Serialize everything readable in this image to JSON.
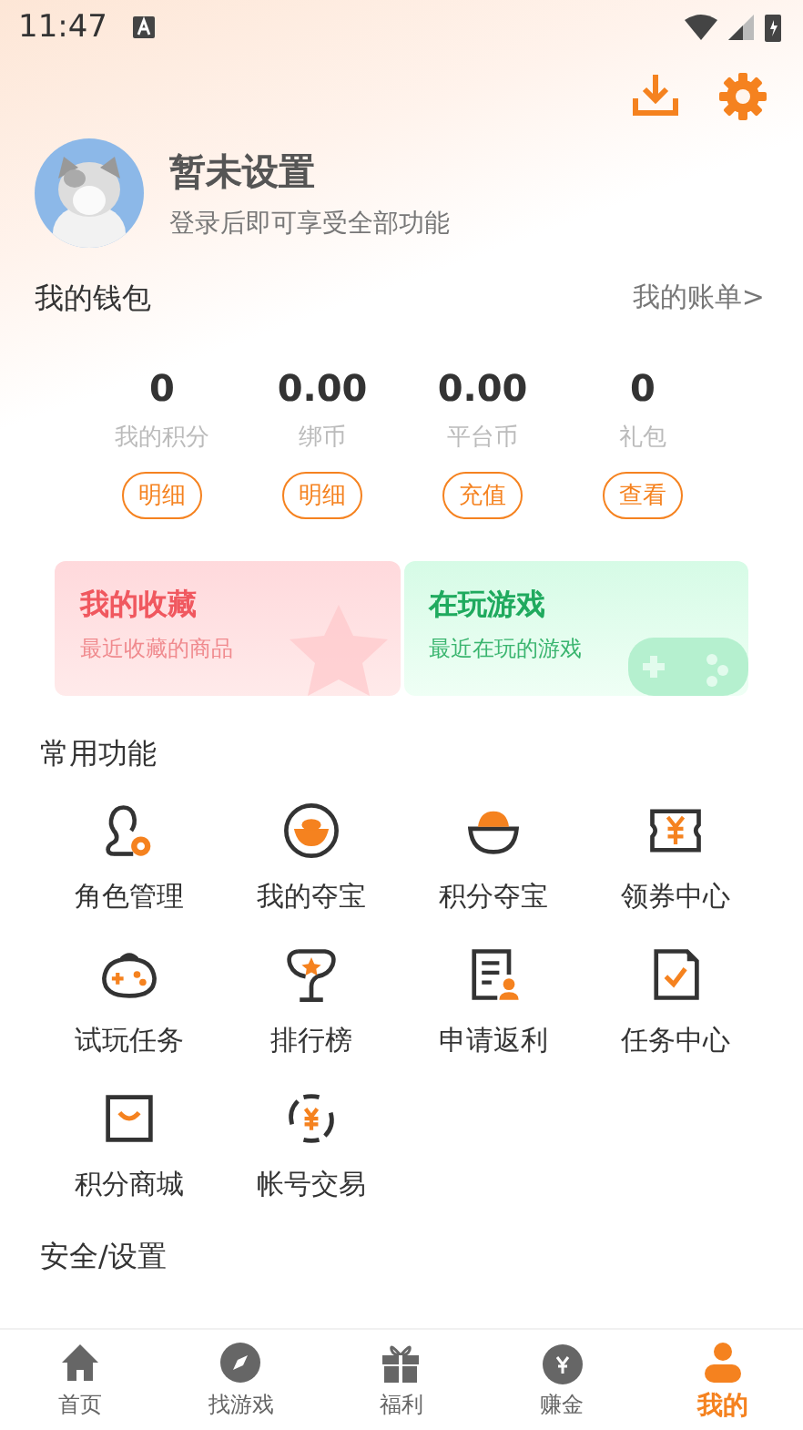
{
  "status_bar": {
    "time": "11:47"
  },
  "profile": {
    "name": "暂未设置",
    "subtitle": "登录后即可享受全部功能"
  },
  "wallet": {
    "title": "我的钱包",
    "link": "我的账单>",
    "stats": [
      {
        "value": "0",
        "label": "我的积分",
        "button": "明细"
      },
      {
        "value": "0.00",
        "label": "绑币",
        "button": "明细"
      },
      {
        "value": "0.00",
        "label": "平台币",
        "button": "充值"
      },
      {
        "value": "0",
        "label": "礼包",
        "button": "查看"
      }
    ]
  },
  "cards": [
    {
      "kind": "favorites",
      "title": "我的收藏",
      "subtitle": "最近收藏的商品"
    },
    {
      "kind": "playing",
      "title": "在玩游戏",
      "subtitle": "最近在玩的游戏"
    }
  ],
  "features": {
    "title": "常用功能",
    "items": [
      "角色管理",
      "我的夺宝",
      "积分夺宝",
      "领券中心",
      "试玩任务",
      "排行榜",
      "申请返利",
      "任务中心",
      "积分商城",
      "帐号交易"
    ]
  },
  "next_section": {
    "title": "安全/设置"
  },
  "bottom_nav": [
    {
      "label": "首页",
      "selected": false
    },
    {
      "label": "找游戏",
      "selected": false
    },
    {
      "label": "福利",
      "selected": false
    },
    {
      "label": "赚金",
      "selected": false
    },
    {
      "label": "我的",
      "selected": true
    }
  ]
}
